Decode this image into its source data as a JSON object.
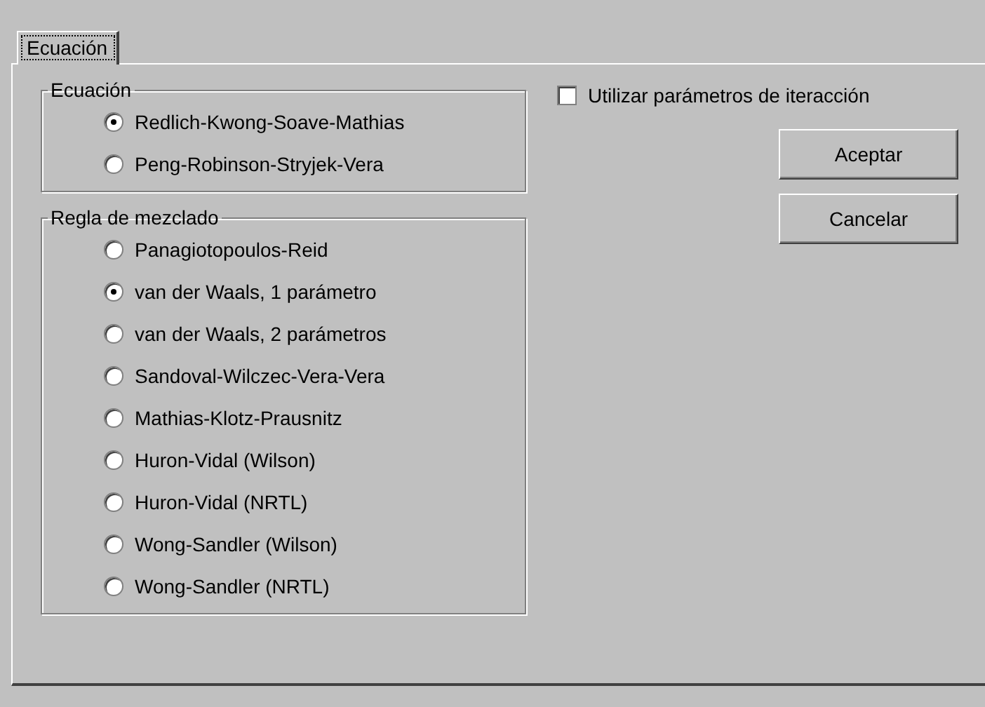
{
  "tabs": [
    {
      "label": "Ecuación",
      "selected": true
    }
  ],
  "equation_group": {
    "title": "Ecuación",
    "options": [
      {
        "label": "Redlich-Kwong-Soave-Mathias",
        "selected": true
      },
      {
        "label": "Peng-Robinson-Stryjek-Vera",
        "selected": false
      }
    ]
  },
  "mixing_rule_group": {
    "title": "Regla de mezclado",
    "options": [
      {
        "label": "Panagiotopoulos-Reid",
        "selected": false
      },
      {
        "label": "van der Waals, 1 parámetro",
        "selected": true
      },
      {
        "label": "van der Waals, 2 parámetros",
        "selected": false
      },
      {
        "label": "Sandoval-Wilczec-Vera-Vera",
        "selected": false
      },
      {
        "label": "Mathias-Klotz-Prausnitz",
        "selected": false
      },
      {
        "label": "Huron-Vidal (Wilson)",
        "selected": false
      },
      {
        "label": "Huron-Vidal (NRTL)",
        "selected": false
      },
      {
        "label": "Wong-Sandler (Wilson)",
        "selected": false
      },
      {
        "label": "Wong-Sandler (NRTL)",
        "selected": false
      }
    ]
  },
  "interaction_checkbox": {
    "label": "Utilizar parámetros de iteracción",
    "checked": false
  },
  "buttons": [
    "Aceptar",
    "Cancelar"
  ]
}
